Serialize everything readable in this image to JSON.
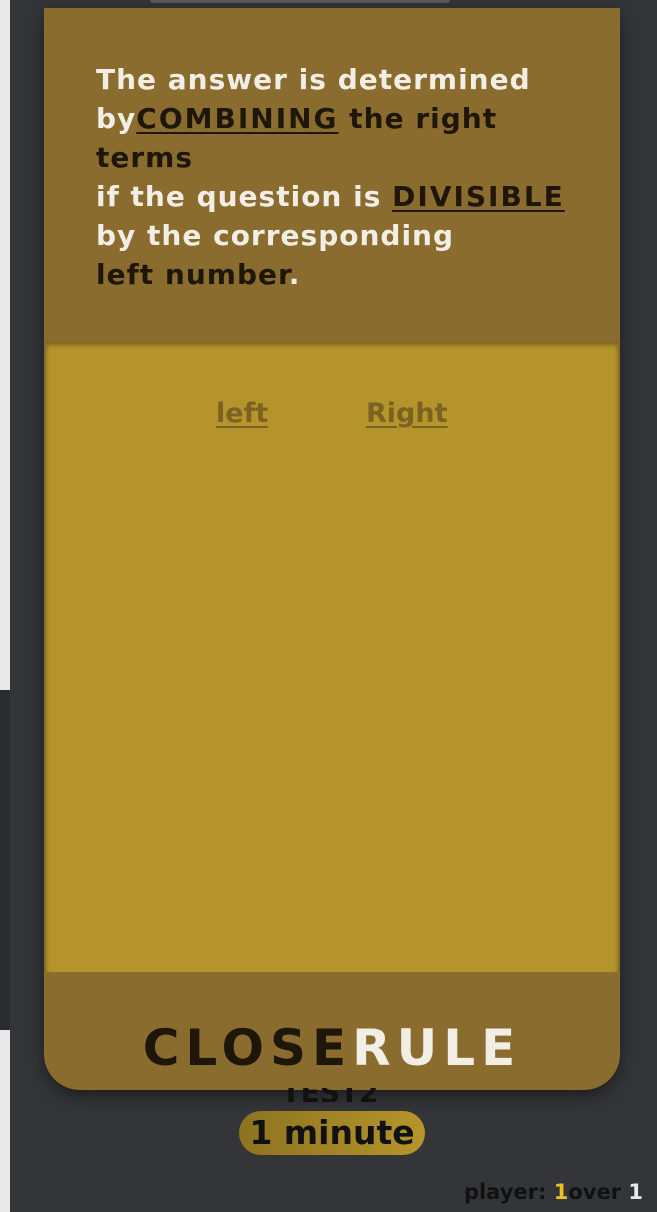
{
  "rule": {
    "line1": "The answer is determined",
    "line2_prefix": "by",
    "keyword1": "COMBINING",
    "line2_suffix": " the right terms",
    "line3_prefix": "if the question is ",
    "keyword2": "DIVISIBLE",
    "line4": "by the corresponding",
    "line5": "left number",
    "line5_end": "."
  },
  "columns": {
    "left": "left",
    "right": "Right"
  },
  "close_button": {
    "part1": "CLOSE",
    "part2": "RULE"
  },
  "timer": {
    "label": "1 minute",
    "peek": "TEST2"
  },
  "player": {
    "label": "player:",
    "current": "1",
    "over": "over",
    "total": "1"
  },
  "colors": {
    "modal_bg": "#8a6c2e",
    "panel_bg": "#b5952b",
    "accent_yellow": "#e8c31b",
    "page_bg": "#343538"
  }
}
